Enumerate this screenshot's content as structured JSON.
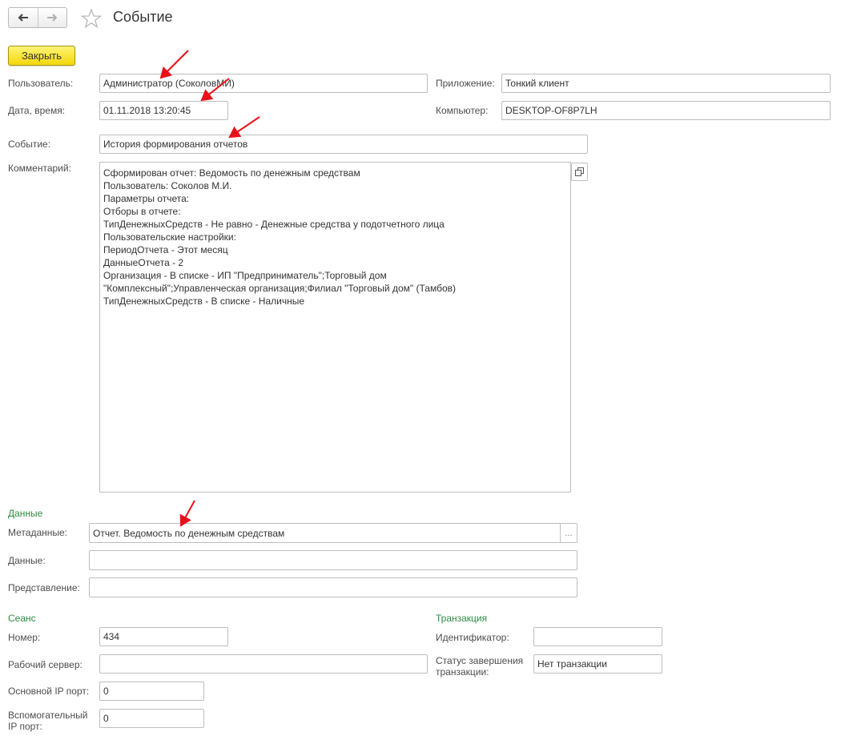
{
  "header": {
    "title": "Событие"
  },
  "toolbar": {
    "close_label": "Закрыть"
  },
  "fields": {
    "user_label": "Пользователь:",
    "user_value": "Администратор (СоколовМИ)",
    "app_label": "Приложение:",
    "app_value": "Тонкий клиент",
    "datetime_label": "Дата, время:",
    "datetime_value": "01.11.2018 13:20:45",
    "computer_label": "Компьютер:",
    "computer_value": "DESKTOP-OF8P7LH",
    "event_label": "Событие:",
    "event_value": "История формирования отчетов",
    "comment_label": "Комментарий:"
  },
  "comment_lines": [
    "Сформирован отчет: Ведомость по денежным средствам",
    "Пользователь: Соколов М.И.",
    "Параметры отчета:",
    "Отборы в отчете:",
    "ТипДенежныхСредств - Не равно - Денежные средства у подотчетного лица",
    "Пользовательские настройки:",
    "ПериодОтчета - Этот месяц",
    "ДанныеОтчета - 2",
    "Организация - В списке - ИП \"Предприниматель\";Торговый дом",
    "\"Комплексный\";Управленческая организация;Филиал \"Торговый дом\" (Тамбов)",
    "ТипДенежныхСредств - В списке - Наличные"
  ],
  "data_section": {
    "title": "Данные",
    "metadata_label": "Метаданные:",
    "metadata_value": "Отчет. Ведомость по денежным средствам",
    "choose_glyph": "...",
    "data_label": "Данные:",
    "data_value": "",
    "presentation_label": "Представление:",
    "presentation_value": ""
  },
  "session_section": {
    "title": "Сеанс",
    "number_label": "Номер:",
    "number_value": "434",
    "server_label": "Рабочий сервер:",
    "server_value": "",
    "main_port_label": "Основной IP порт:",
    "main_port_value": "0",
    "aux_port_label": "Вспомогательный IP порт:",
    "aux_port_value": "0"
  },
  "transaction_section": {
    "title": "Транзакция",
    "id_label": "Идентификатор:",
    "id_value": "",
    "status_label": "Статус завершения транзакции:",
    "status_value": "Нет транзакции"
  },
  "icons": {
    "back": "arrow-left-icon",
    "forward": "arrow-right-icon",
    "favorite": "star-icon",
    "expand": "open-window-icon",
    "annotation": "red-arrow-icon"
  },
  "colors": {
    "accent_green": "#2e8b43",
    "close_button": "#f3d70a",
    "annotation_red": "#e8111a"
  }
}
